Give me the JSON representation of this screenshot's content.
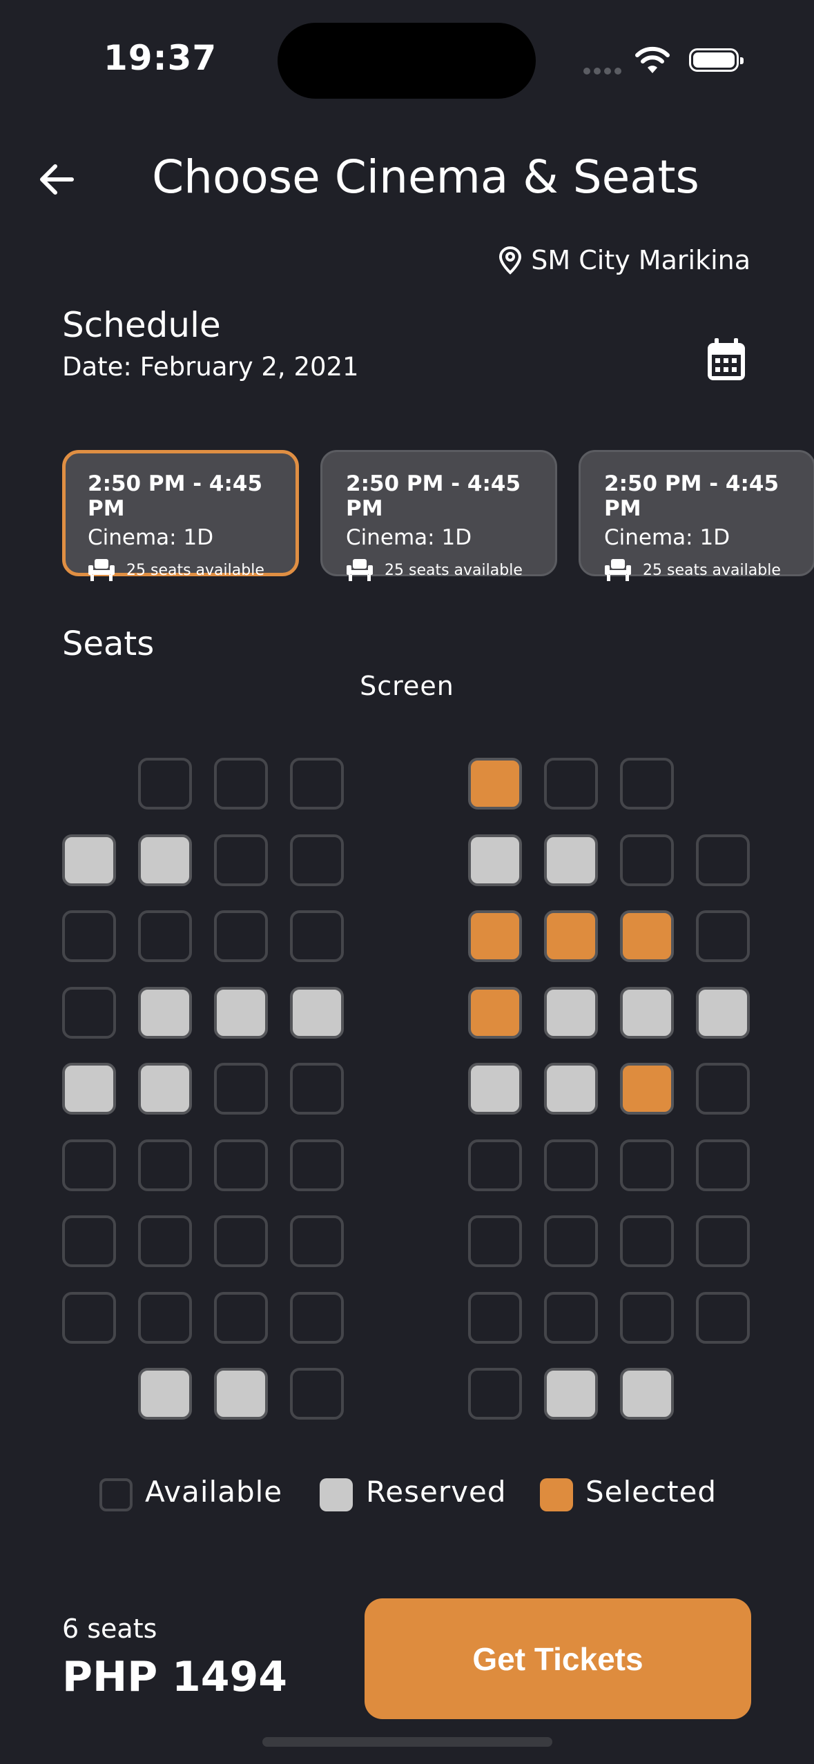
{
  "status_bar": {
    "time": "19:37"
  },
  "header": {
    "title": "Choose Cinema & Seats"
  },
  "location": {
    "name": "SM City Marikina"
  },
  "schedule": {
    "title": "Schedule",
    "date": "Date: February 2, 2021"
  },
  "showtimes": [
    {
      "time": "2:50 PM - 4:45 PM",
      "cinema": "Cinema: 1D",
      "seats": "25 seats available",
      "active": true
    },
    {
      "time": "2:50 PM - 4:45 PM",
      "cinema": "Cinema: 1D",
      "seats": "25 seats available",
      "active": false
    },
    {
      "time": "2:50 PM - 4:45 PM",
      "cinema": "Cinema: 1D",
      "seats": "25 seats available",
      "active": false
    }
  ],
  "seats_section": {
    "title": "Seats",
    "screen_label": "Screen"
  },
  "seat_map": {
    "legend": "A = available, R = reserved, S = selected, _ = no seat",
    "left_block": [
      "_AAA",
      "RRAA",
      "AAAA",
      "ARRR",
      "RRAA",
      "AAAA",
      "AAAA",
      "AAAA",
      "_RRA"
    ],
    "right_block": [
      "SAA_",
      "RRAA",
      "SSSA",
      "SRRR",
      "RRSA",
      "AAAA",
      "AAAA",
      "AAAA",
      "ARR_"
    ]
  },
  "legend": {
    "available": "Available",
    "reserved": "Reserved",
    "selected": "Selected"
  },
  "footer": {
    "seat_count": "6 seats",
    "price": "PHP 1494",
    "button": "Get Tickets"
  },
  "colors": {
    "background": "#1f2027",
    "accent": "#de8c3e",
    "reserved": "#c9c9c9",
    "card": "#4a4a4f"
  }
}
